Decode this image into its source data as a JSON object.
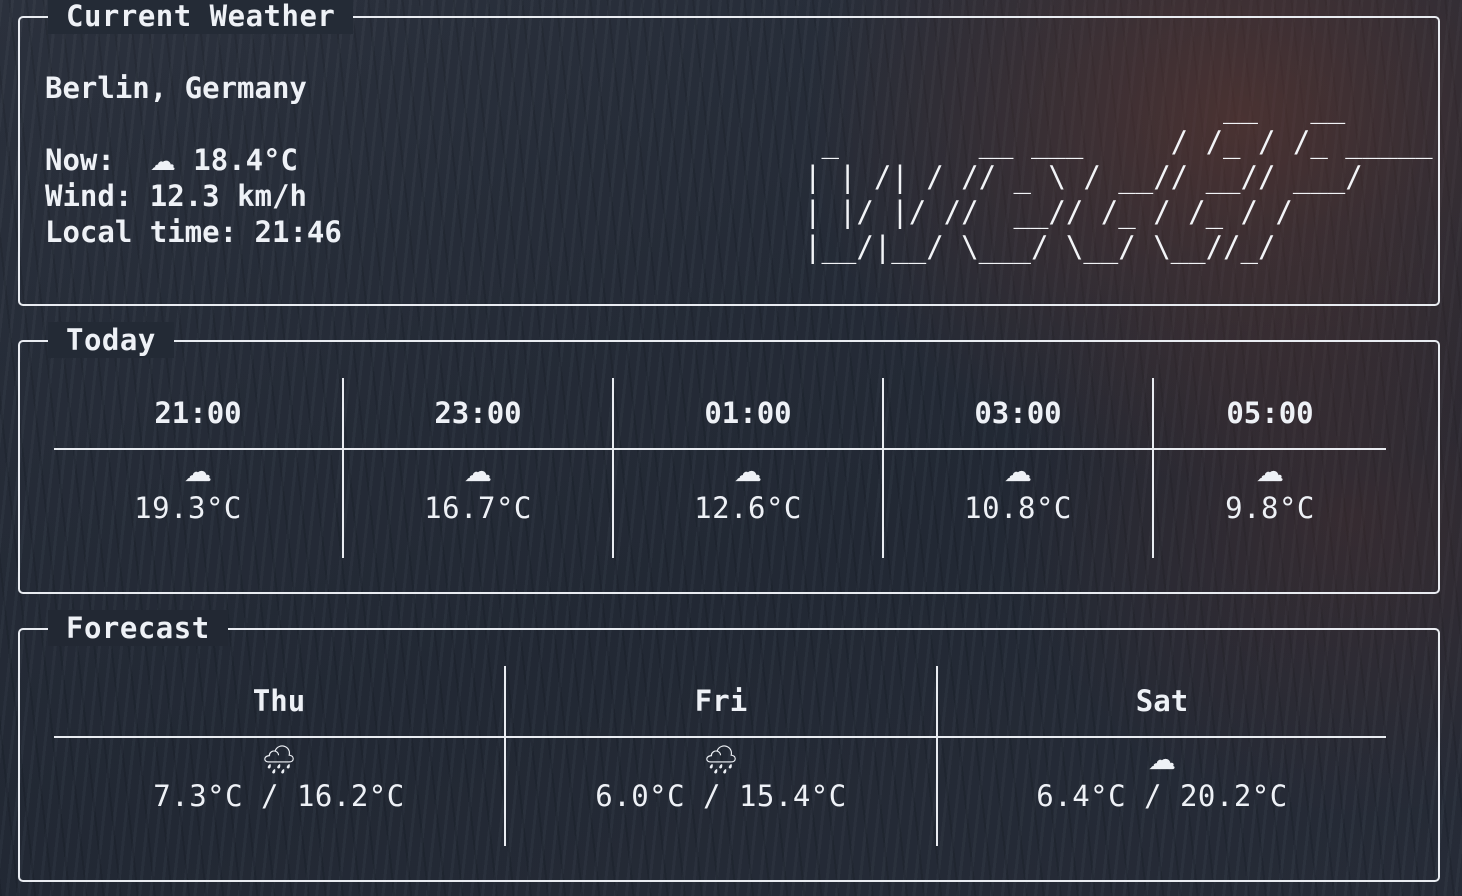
{
  "current": {
    "title": "Current Weather",
    "location": "Berlin, Germany",
    "now_label": "Now:",
    "now_icon": "☁",
    "now_temp": "18.4°C",
    "wind_label": "Wind:",
    "wind_value": "12.3 km/h",
    "local_time_label": "Local time:",
    "local_time_value": "21:46",
    "ascii_art": "                        __   __\n _        __ ___     / /_ / /_ _____\n| | /| / // _ \\ / __// __// ___/\n| |/ |/ //  __// /_ / /_ / /\n|__/|__/ \\___/ \\__/ \\__//_/"
  },
  "today": {
    "title": "Today",
    "hours": [
      {
        "time": "21:00",
        "icon": "☁",
        "icon_name": "cloud-icon",
        "temp": "19.3°C"
      },
      {
        "time": "23:00",
        "icon": "☁",
        "icon_name": "cloud-icon",
        "temp": "16.7°C"
      },
      {
        "time": "01:00",
        "icon": "☁",
        "icon_name": "cloud-icon",
        "temp": "12.6°C"
      },
      {
        "time": "03:00",
        "icon": "☁",
        "icon_name": "cloud-icon",
        "temp": "10.8°C"
      },
      {
        "time": "05:00",
        "icon": "☁",
        "icon_name": "cloud-icon",
        "temp": "9.8°C"
      }
    ]
  },
  "forecast": {
    "title": "Forecast",
    "days": [
      {
        "day": "Thu",
        "icon": "🌧",
        "icon_name": "rain-cloud-icon",
        "temps": "7.3°C / 16.2°C"
      },
      {
        "day": "Fri",
        "icon": "🌧",
        "icon_name": "rain-cloud-icon",
        "temps": "6.0°C / 15.4°C"
      },
      {
        "day": "Sat",
        "icon": "☁",
        "icon_name": "cloud-icon",
        "temps": "6.4°C / 20.2°C"
      }
    ]
  }
}
